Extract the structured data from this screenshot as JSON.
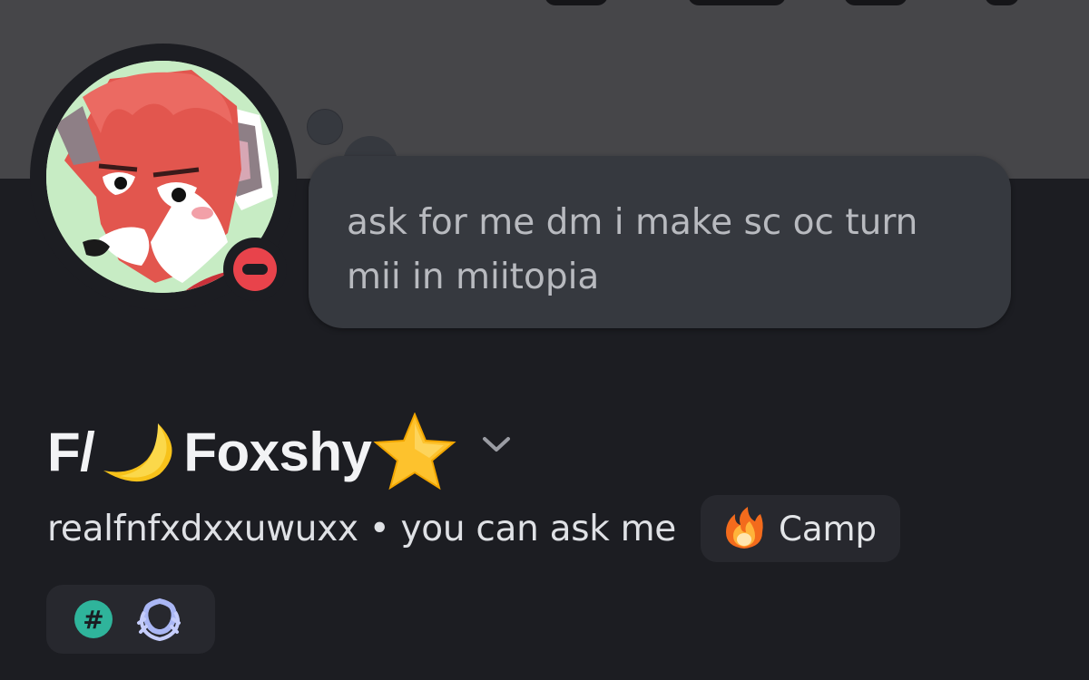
{
  "banner": {
    "color": "#464649"
  },
  "profile": {
    "avatar_icon": "fox-character-avatar",
    "status": "do-not-disturb",
    "status_color": "#e8434b",
    "custom_status": "ask for me dm i make sc oc turn mii in miitopia",
    "display_name_prefix": "F/",
    "display_name_moon": "🌙",
    "display_name_main": "Foxshy",
    "display_name_star": "⭐",
    "username": "realfnfxdxxuwuxx",
    "separator": "•",
    "pronouns": "you can ask me",
    "server_tag": {
      "icon": "flame-icon",
      "label": "Camp"
    }
  },
  "badges": [
    {
      "name": "hashtag-badge",
      "glyph": "#",
      "color": "#2fb49b"
    },
    {
      "name": "laurel-badge",
      "color": "#aab7f5"
    }
  ]
}
